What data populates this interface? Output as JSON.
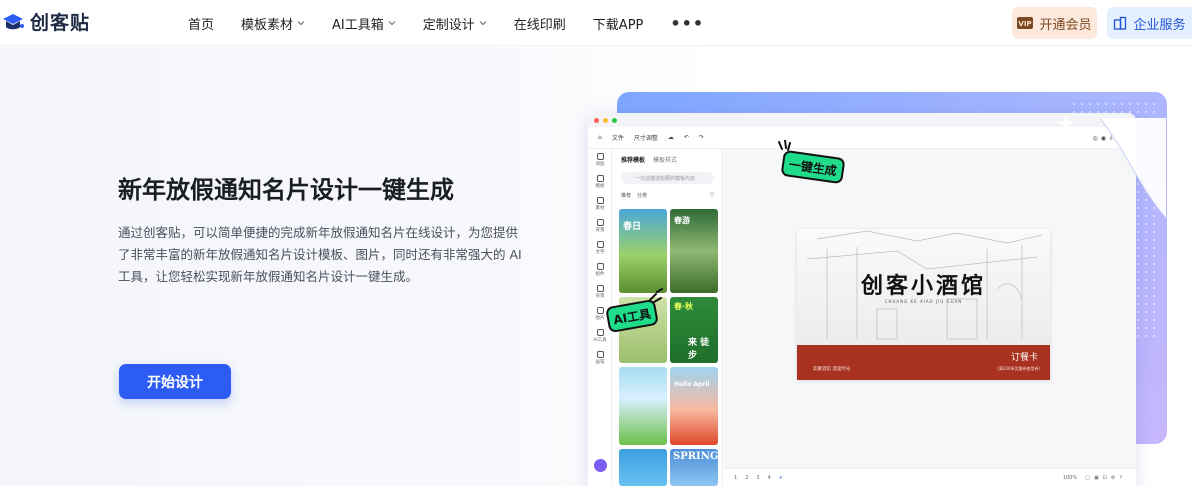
{
  "header": {
    "logo_text": "创客贴",
    "nav": [
      {
        "label": "首页",
        "has_dropdown": false
      },
      {
        "label": "模板素材",
        "has_dropdown": true
      },
      {
        "label": "AI工具箱",
        "has_dropdown": true
      },
      {
        "label": "定制设计",
        "has_dropdown": true
      },
      {
        "label": "在线印刷",
        "has_dropdown": false
      },
      {
        "label": "下载APP",
        "has_dropdown": false
      }
    ],
    "more_label": "•••",
    "vip_label": "开通会员",
    "vip_badge": "VIP",
    "enterprise_label": "企业服务"
  },
  "hero": {
    "title": "新年放假通知名片设计一键生成",
    "description": "通过创客贴，可以简单便捷的完成新年放假通知名片在线设计，为您提供了非常丰富的新年放假通知名片设计模板、图片，同时还有非常强大的 AI 工具，让您轻松实现新年放假通知名片设计一键生成。",
    "cta_label": "开始设计"
  },
  "mockup": {
    "toolbar": {
      "file": "文件",
      "size": "尺寸调整"
    },
    "sidebar": [
      "添加",
      "模板",
      "素材",
      "背景",
      "文字",
      "组件",
      "背景",
      "图片",
      "AI工具",
      "画笔"
    ],
    "panel_tabs": [
      "推荐模板",
      "模板样式"
    ],
    "search_placeholder": "一句话描述想要的模板内容",
    "filter": [
      "推荐",
      "分类"
    ],
    "template_texts": [
      "春日",
      "春游",
      "春·秋",
      "来 徒步",
      "Hello April",
      "SPRING"
    ],
    "sticker_one_click": "一键生成",
    "sticker_ai": "AI工具",
    "card": {
      "title": "创客小酒馆",
      "subtitle": "CHUANG KE XIAO JIU GUAN",
      "order_label": "订餐卡",
      "left_text": "友聚酒馆 酒里时光",
      "right_text": "(满200享优惠券使用券)"
    },
    "pages": [
      "1",
      "2",
      "3",
      "4",
      "+"
    ],
    "zoom": "100%",
    "colors": {
      "brand": "#2d5cf5",
      "sticker": "#1fdc8a",
      "band": "#a8321f"
    }
  }
}
